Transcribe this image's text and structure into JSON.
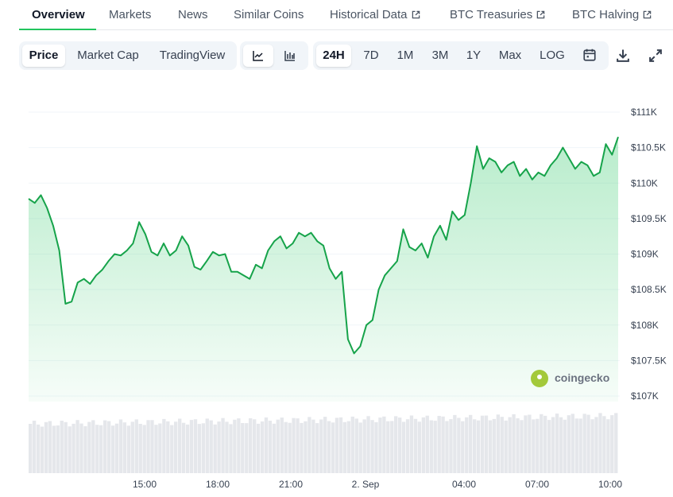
{
  "nav": {
    "tabs": [
      {
        "label": "Overview"
      },
      {
        "label": "Markets"
      },
      {
        "label": "News"
      },
      {
        "label": "Similar Coins"
      },
      {
        "label": "Historical Data"
      },
      {
        "label": "BTC Treasuries"
      },
      {
        "label": "BTC Halving"
      }
    ],
    "active": "Overview"
  },
  "chart_type_tabs": {
    "price": "Price",
    "market_cap": "Market Cap",
    "tradingview": "TradingView",
    "selected": "Price"
  },
  "chart_style": {
    "selected": "line-chart-icon"
  },
  "ranges": {
    "items": [
      "24H",
      "7D",
      "1M",
      "3M",
      "1Y",
      "Max",
      "LOG"
    ],
    "selected": "24H"
  },
  "tools": {
    "calendar": "calendar-icon",
    "download": "download-icon",
    "fullscreen": "fullscreen-icon"
  },
  "watermark": "coingecko",
  "colors": {
    "line": "#16a34a",
    "accent": "#22c55e",
    "volume": "#e5e7eb"
  },
  "chart_data": {
    "type": "line",
    "title": "",
    "xlabel": "",
    "ylabel": "",
    "x_tick_labels": [
      "15:00",
      "18:00",
      "21:00",
      "2. Sep",
      "04:00",
      "07:00",
      "10:00"
    ],
    "y_tick_labels": [
      "$107K",
      "$107.5K",
      "$108K",
      "$108.5K",
      "$109K",
      "$109.5K",
      "$110K",
      "$110.5K",
      "$111K"
    ],
    "ylim": [
      107000,
      111000
    ],
    "grid": true,
    "series": [
      {
        "values": [
          109780,
          109720,
          109830,
          109650,
          109400,
          109050,
          108300,
          108330,
          108600,
          108650,
          108580,
          108700,
          108780,
          108900,
          109000,
          108980,
          109050,
          109150,
          109450,
          109280,
          109030,
          108980,
          109150,
          108980,
          109050,
          109250,
          109120,
          108820,
          108780,
          108900,
          109030,
          108980,
          109000,
          108750,
          108750,
          108700,
          108650,
          108850,
          108800,
          109050,
          109180,
          109250,
          109080,
          109150,
          109300,
          109250,
          109300,
          109180,
          109120,
          108800,
          108650,
          108750,
          107800,
          107600,
          107700,
          108000,
          108070,
          108500,
          108700,
          108800,
          108900,
          109350,
          109100,
          109050,
          109150,
          108950,
          109250,
          109400,
          109200,
          109600,
          109480,
          109550,
          110000,
          110520,
          110200,
          110350,
          110300,
          110150,
          110250,
          110300,
          110100,
          110200,
          110050,
          110150,
          110100,
          110250,
          110350,
          110500,
          110350,
          110200,
          110300,
          110250,
          110100,
          110150,
          110550,
          110400,
          110650
        ]
      }
    ],
    "volume_shown": true
  }
}
